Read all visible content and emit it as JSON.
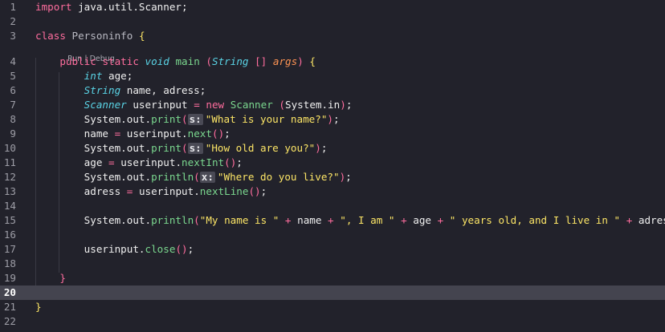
{
  "editor": {
    "current_line": 20,
    "codelens": {
      "run": "Run",
      "separator": " | ",
      "debug": "Debug"
    },
    "lines": [
      {
        "n": "1"
      },
      {
        "n": "2"
      },
      {
        "n": "3"
      },
      {
        "n": "4"
      },
      {
        "n": "5"
      },
      {
        "n": "6"
      },
      {
        "n": "7"
      },
      {
        "n": "8"
      },
      {
        "n": "9"
      },
      {
        "n": "10"
      },
      {
        "n": "11"
      },
      {
        "n": "12"
      },
      {
        "n": "13"
      },
      {
        "n": "14"
      },
      {
        "n": "15"
      },
      {
        "n": "16"
      },
      {
        "n": "17"
      },
      {
        "n": "18"
      },
      {
        "n": "19"
      },
      {
        "n": "20"
      },
      {
        "n": "21"
      },
      {
        "n": "22"
      }
    ],
    "tokens": {
      "import": "import",
      "import_path": "java.util.Scanner",
      "semi": ";",
      "class_kw": "class",
      "class_name": "Personinfo",
      "lbrace": "{",
      "rbrace": "}",
      "public": "public",
      "static": "static",
      "void": "void",
      "main": "main",
      "lparen": "(",
      "rparen": ")",
      "String": "String",
      "brackets": "[]",
      "args": "args",
      "int": "int",
      "age": "age",
      "name_adress": "name, adress",
      "Scanner": "Scanner",
      "userinput": "userinput",
      "eq": "=",
      "new": "new",
      "system_in": "System.in",
      "system_out": "System.out.",
      "print": "print",
      "println": "println",
      "hint_s": "s:",
      "hint_x": "x:",
      "str_name": "\"What is your name?\"",
      "str_age": "\"How old are you?\"",
      "str_live": "\"Where do you live?\"",
      "name": "name",
      "adress": "adress",
      "dot": ".",
      "next": "next",
      "nextInt": "nextInt",
      "nextLine": "nextLine",
      "empty_parens": "()",
      "plus": "+",
      "str_myname": "\"My name is \"",
      "str_iam": "\", I am \"",
      "str_years": "\" years old, and I live in \"",
      "close": "close"
    }
  },
  "colors": {
    "background": "#22222b",
    "current_line": "#44444f",
    "keyword": "#ff6d9e",
    "type": "#5ad4e6",
    "function": "#7bd88f",
    "string": "#fce566",
    "parameter": "#fd9353"
  }
}
